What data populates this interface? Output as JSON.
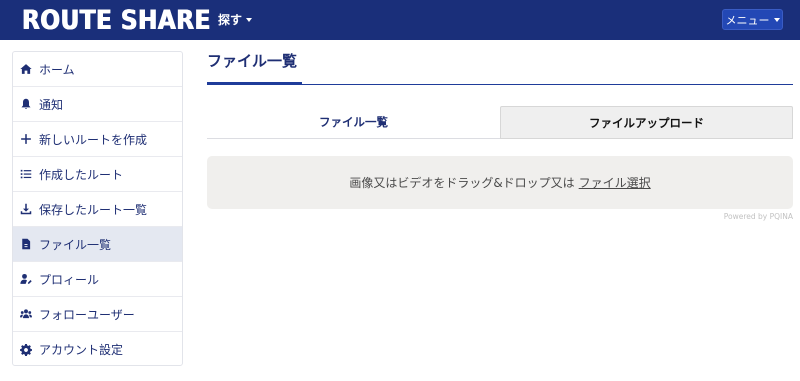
{
  "header": {
    "brand": "ROUTE SHARE",
    "search_dropdown": "探す",
    "menu_button": "メニュー"
  },
  "sidebar": {
    "items": [
      {
        "label": "ホーム",
        "icon": "home-icon"
      },
      {
        "label": "通知",
        "icon": "bell-icon"
      },
      {
        "label": "新しいルートを作成",
        "icon": "plus-icon"
      },
      {
        "label": "作成したルート",
        "icon": "list-icon"
      },
      {
        "label": "保存したルート一覧",
        "icon": "download-icon"
      },
      {
        "label": "ファイル一覧",
        "icon": "file-icon",
        "active": true
      },
      {
        "label": "プロィール",
        "icon": "user-edit-icon"
      },
      {
        "label": "フォローユーザー",
        "icon": "users-icon"
      },
      {
        "label": "アカウント設定",
        "icon": "gear-icon"
      }
    ]
  },
  "main": {
    "title": "ファイル一覧",
    "tabs": [
      {
        "label": "ファイル一覧",
        "active": true
      },
      {
        "label": "ファイルアップロード",
        "active": false
      }
    ],
    "dropzone": {
      "text": "画像又はビデオをドラッグ&ドロップ又は",
      "browse": "ファイル選択"
    },
    "powered_by": "Powered by PQINA"
  },
  "colors": {
    "navbar": "#1a2f7a",
    "accent": "#1f3c9a",
    "menu_button": "#2348b5",
    "active_item_bg": "#e4e8f1"
  }
}
